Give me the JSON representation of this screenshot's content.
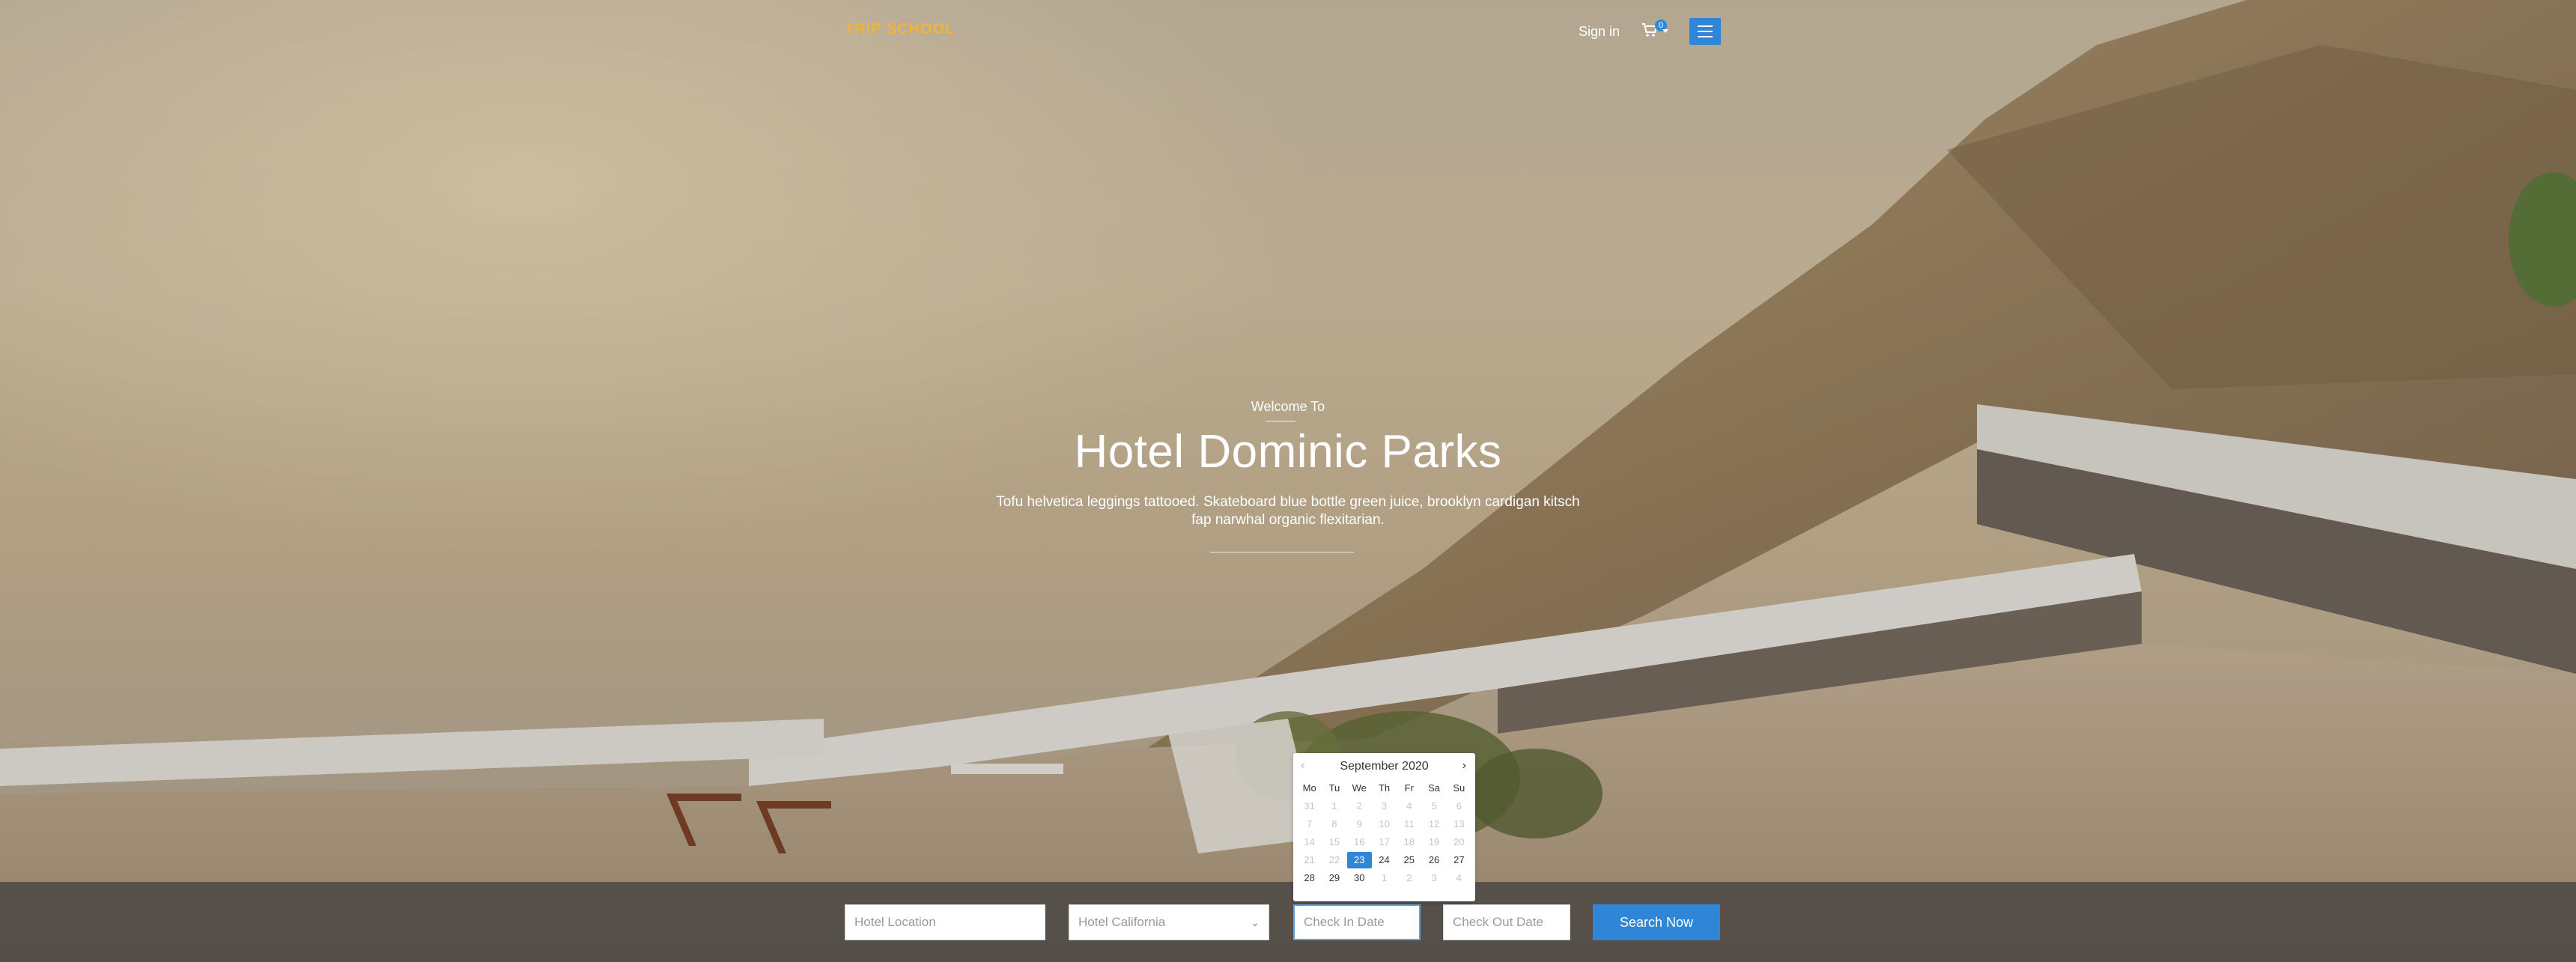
{
  "header": {
    "logo": "TRIP SCHOOL",
    "signin_label": "Sign in",
    "cart_count": "0"
  },
  "hero": {
    "kicker": "Welcome To",
    "title": "Hotel Dominic Parks",
    "description": "Tofu helvetica leggings tattooed. Skateboard blue bottle green juice, brooklyn cardigan kitsch fap narwhal organic flexitarian."
  },
  "search": {
    "location_placeholder": "Hotel Location",
    "hotel_selected": "Hotel California",
    "checkin_placeholder": "Check In Date",
    "checkout_placeholder": "Check Out Date",
    "button_label": "Search Now"
  },
  "datepicker": {
    "month_label": "September 2020",
    "prev_icon": "‹",
    "next_icon": "›",
    "weekdays": [
      "Mo",
      "Tu",
      "We",
      "Th",
      "Fr",
      "Sa",
      "Su"
    ],
    "weeks": [
      [
        {
          "d": "31",
          "muted": true
        },
        {
          "d": "1",
          "muted": true
        },
        {
          "d": "2",
          "muted": true
        },
        {
          "d": "3",
          "muted": true
        },
        {
          "d": "4",
          "muted": true
        },
        {
          "d": "5",
          "muted": true
        },
        {
          "d": "6",
          "muted": true
        }
      ],
      [
        {
          "d": "7",
          "muted": true
        },
        {
          "d": "8",
          "muted": true
        },
        {
          "d": "9",
          "muted": true
        },
        {
          "d": "10",
          "muted": true
        },
        {
          "d": "11",
          "muted": true
        },
        {
          "d": "12",
          "muted": true
        },
        {
          "d": "13",
          "muted": true
        }
      ],
      [
        {
          "d": "14",
          "muted": true
        },
        {
          "d": "15",
          "muted": true
        },
        {
          "d": "16",
          "muted": true
        },
        {
          "d": "17",
          "muted": true
        },
        {
          "d": "18",
          "muted": true
        },
        {
          "d": "19",
          "muted": true
        },
        {
          "d": "20",
          "muted": true
        }
      ],
      [
        {
          "d": "21",
          "muted": true
        },
        {
          "d": "22",
          "muted": true
        },
        {
          "d": "23",
          "selected": true
        },
        {
          "d": "24"
        },
        {
          "d": "25"
        },
        {
          "d": "26"
        },
        {
          "d": "27"
        }
      ],
      [
        {
          "d": "28"
        },
        {
          "d": "29"
        },
        {
          "d": "30"
        },
        {
          "d": "1",
          "muted": true
        },
        {
          "d": "2",
          "muted": true
        },
        {
          "d": "3",
          "muted": true
        },
        {
          "d": "4",
          "muted": true
        }
      ]
    ]
  },
  "colors": {
    "accent": "#2f86d6",
    "logo": "#f2b33a"
  }
}
